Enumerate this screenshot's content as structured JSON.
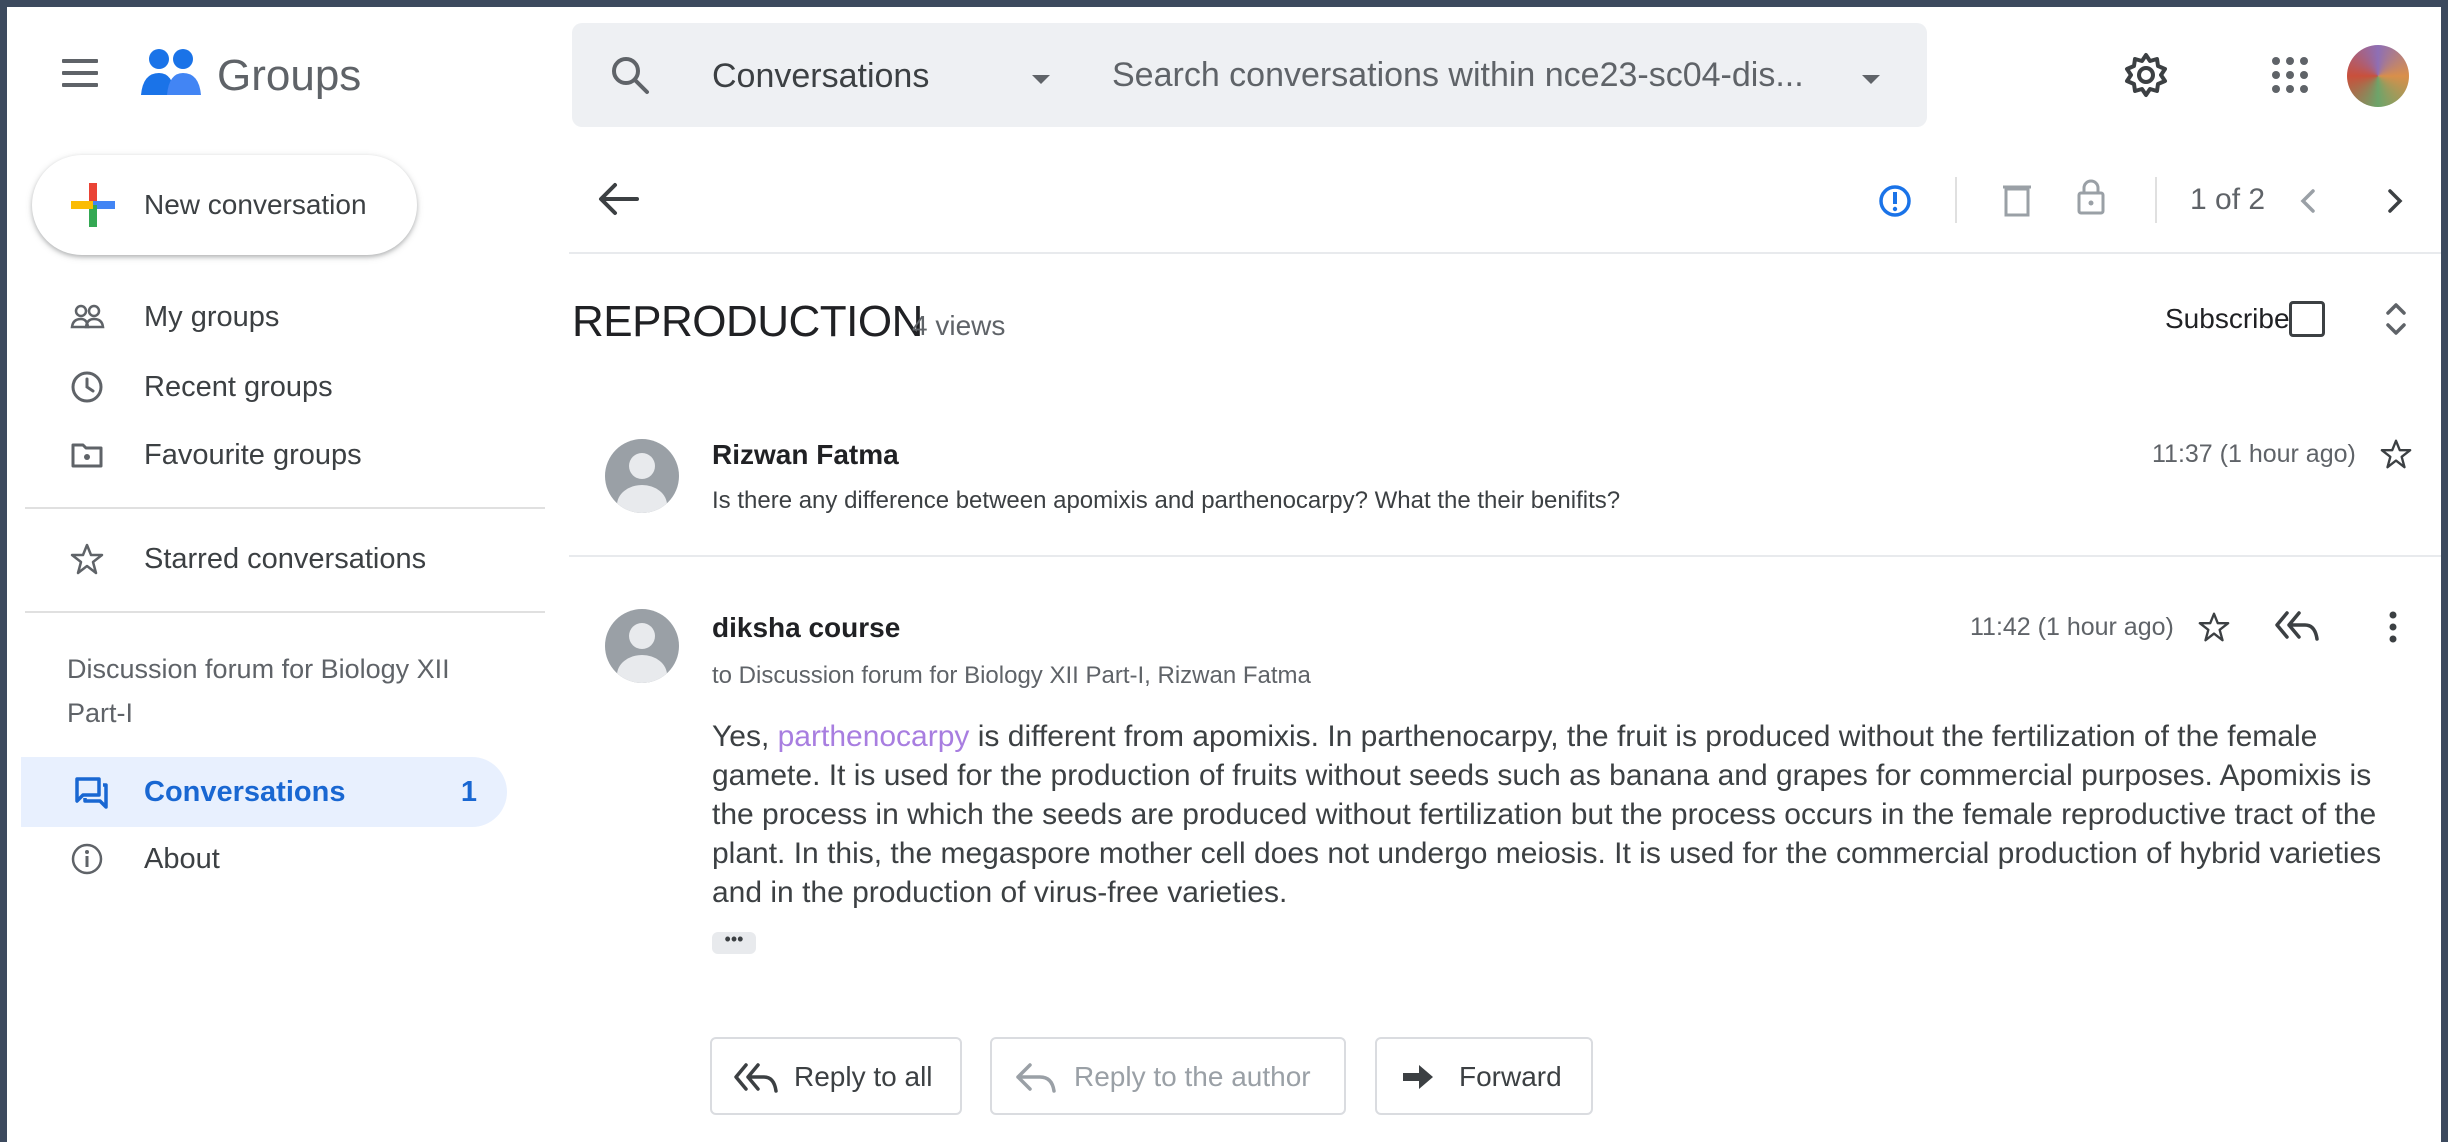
{
  "app": {
    "title": "Groups",
    "menu_icon": "hamburger-menu-icon",
    "logo_icon": "groups-logo-icon"
  },
  "search": {
    "scope": "Conversations",
    "placeholder": "Search conversations within nce23-sc04-dis..."
  },
  "header_icons": [
    "gear-icon",
    "apps-grid-icon",
    "account-avatar"
  ],
  "sidebar": {
    "new_conversation": "New conversation",
    "items": [
      {
        "label": "My groups",
        "icon": "people-icon"
      },
      {
        "label": "Recent groups",
        "icon": "clock-icon"
      },
      {
        "label": "Favourite groups",
        "icon": "folder-star-icon"
      },
      {
        "label": "Starred conversations",
        "icon": "star-icon"
      }
    ],
    "forum_name": "Discussion forum for Biology XII Part-I",
    "forum_items": [
      {
        "label": "Conversations",
        "count": "1",
        "active": true,
        "icon": "conversations-icon"
      },
      {
        "label": "About",
        "icon": "info-icon"
      }
    ]
  },
  "toolbar": {
    "pager": "1 of 2"
  },
  "thread": {
    "title": "REPRODUCTION",
    "views": "4 views",
    "subscribe_label": "Subscribe",
    "subscribed": false
  },
  "messages": [
    {
      "author": "Rizwan Fatma",
      "snippet": "Is there any difference between apomixis and parthenocarpy? What the their benifits?",
      "time": "11:37 (1 hour ago)"
    },
    {
      "author": "diksha course",
      "recipients": "to Discussion forum for Biology XII Part-I, Rizwan Fatma",
      "time": "11:42 (1 hour ago)",
      "body_before_link": "Yes, ",
      "body_link": "parthenocarpy",
      "body_after_link": " is different from apomixis. In parthenocarpy, the fruit is produced without the fertilization of the female gamete. It is used for the production of fruits without seeds such as banana and grapes for commercial purposes. Apomixis is the process in which the seeds are produced without fertilization but the process occurs in the female reproductive tract of the plant. In this, the megaspore mother cell does not undergo meiosis. It is used for the commercial production of hybrid varieties and in the production of virus-free varieties.",
      "ellipsis": "•••"
    }
  ],
  "actions": {
    "reply_all": "Reply to all",
    "reply_author": "Reply to the author",
    "forward": "Forward"
  },
  "colors": {
    "accent": "#1a73e8",
    "active_bg": "#e8f0fe",
    "link": "#a87ee0",
    "frame": "#3c4a5e"
  }
}
